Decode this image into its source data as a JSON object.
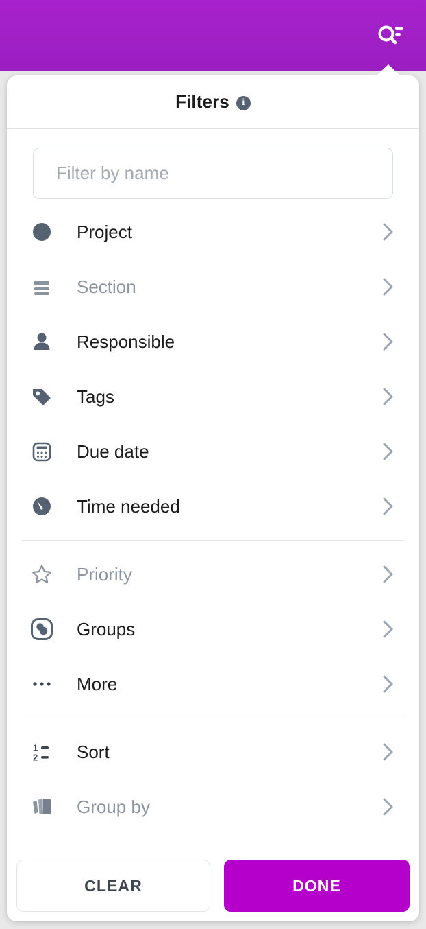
{
  "appbar": {
    "background_color": "#a020c6",
    "search_filter_icon": "search-filter-icon"
  },
  "popup": {
    "title": "Filters",
    "info_icon_label": "i",
    "info_icon_name": "info-icon"
  },
  "search": {
    "placeholder": "Filter by name",
    "value": ""
  },
  "groups": [
    {
      "items": [
        {
          "label": "Project",
          "icon": "circle-icon",
          "enabled": true,
          "chevron": "chevron-right-icon"
        },
        {
          "label": "Section",
          "icon": "section-lines-icon",
          "enabled": false,
          "chevron": "chevron-right-icon"
        },
        {
          "label": "Responsible",
          "icon": "person-icon",
          "enabled": true,
          "chevron": "chevron-right-icon"
        },
        {
          "label": "Tags",
          "icon": "tag-icon",
          "enabled": true,
          "chevron": "chevron-right-icon"
        },
        {
          "label": "Due date",
          "icon": "calendar-icon",
          "enabled": true,
          "chevron": "chevron-right-icon"
        },
        {
          "label": "Time needed",
          "icon": "gauge-clock-icon",
          "enabled": true,
          "chevron": "chevron-right-icon"
        }
      ]
    },
    {
      "items": [
        {
          "label": "Priority",
          "icon": "star-outline-icon",
          "enabled": false,
          "chevron": "chevron-right-icon"
        },
        {
          "label": "Groups",
          "icon": "groups-icon",
          "enabled": true,
          "chevron": "chevron-right-icon"
        },
        {
          "label": "More",
          "icon": "ellipsis-icon",
          "enabled": true,
          "chevron": "chevron-right-icon"
        }
      ]
    },
    {
      "items": [
        {
          "label": "Sort",
          "icon": "sort-numeric-icon",
          "enabled": true,
          "chevron": "chevron-right-icon"
        },
        {
          "label": "Group by",
          "icon": "stacked-cards-icon",
          "enabled": false,
          "chevron": "chevron-right-icon"
        }
      ]
    }
  ],
  "footer": {
    "clear_label": "CLEAR",
    "done_label": "DONE",
    "done_color": "#b400ca"
  },
  "colors": {
    "accent": "#a020c6",
    "primary_action": "#b400ca",
    "icon_enabled": "#566272",
    "icon_disabled": "#8b939d",
    "text_enabled": "#1c1c1c",
    "text_disabled": "#8b939d",
    "chevron": "#9aa6b2"
  }
}
